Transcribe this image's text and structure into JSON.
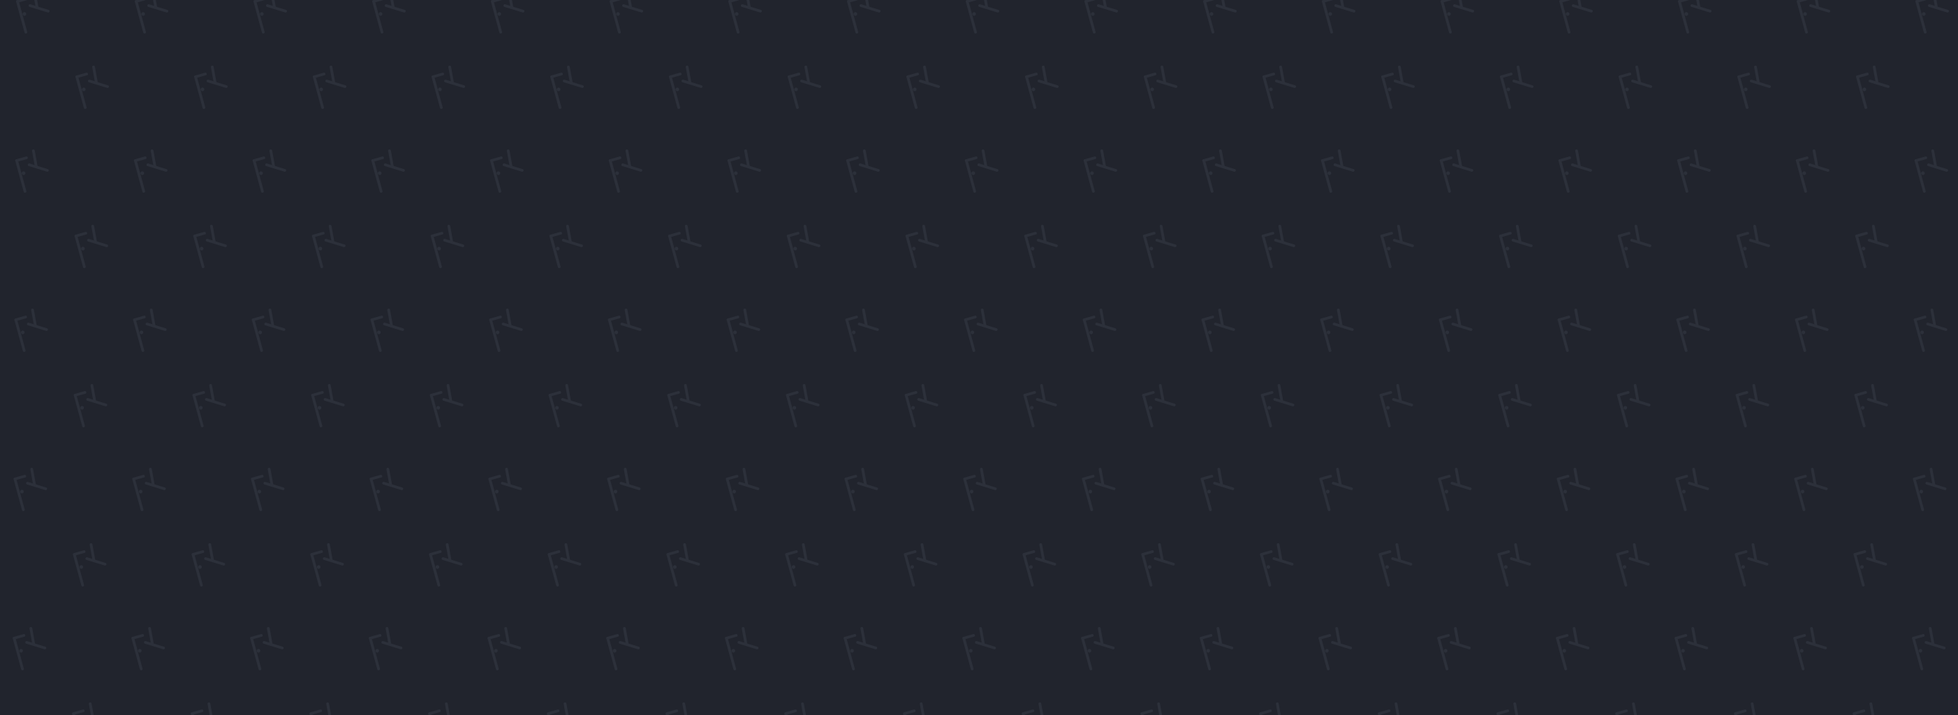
{
  "background": {
    "color": "#21242d",
    "pattern_color": "#2c303a",
    "pattern_icon": "angular-logo-mark-icon"
  }
}
